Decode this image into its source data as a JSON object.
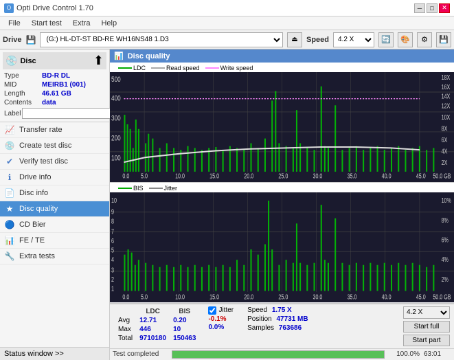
{
  "titlebar": {
    "icon": "O",
    "title": "Opti Drive Control 1.70",
    "min_btn": "─",
    "max_btn": "□",
    "close_btn": "✕"
  },
  "menubar": {
    "items": [
      "File",
      "Start test",
      "Extra",
      "Help"
    ]
  },
  "drivebar": {
    "label": "Drive",
    "drive_value": "(G:)  HL-DT-ST BD-RE  WH16NS48 1.D3",
    "speed_label": "Speed",
    "speed_value": "4.2 X"
  },
  "disc_panel": {
    "title": "Disc",
    "rows": [
      {
        "key": "Type",
        "value": "BD-R DL",
        "color": "blue"
      },
      {
        "key": "MID",
        "value": "MEIRB1 (001)",
        "color": "blue"
      },
      {
        "key": "Length",
        "value": "46.61 GB",
        "color": "blue"
      },
      {
        "key": "Contents",
        "value": "data",
        "color": "blue"
      }
    ],
    "label_key": "Label"
  },
  "sidebar": {
    "items": [
      {
        "id": "transfer-rate",
        "label": "Transfer rate",
        "icon": "📈"
      },
      {
        "id": "create-test-disc",
        "label": "Create test disc",
        "icon": "💿"
      },
      {
        "id": "verify-test-disc",
        "label": "Verify test disc",
        "icon": "✔"
      },
      {
        "id": "drive-info",
        "label": "Drive info",
        "icon": "ℹ"
      },
      {
        "id": "disc-info",
        "label": "Disc info",
        "icon": "📄"
      },
      {
        "id": "disc-quality",
        "label": "Disc quality",
        "icon": "★",
        "active": true
      },
      {
        "id": "cd-bier",
        "label": "CD Bier",
        "icon": "🔵"
      },
      {
        "id": "fe-te",
        "label": "FE / TE",
        "icon": "📊"
      },
      {
        "id": "extra-tests",
        "label": "Extra tests",
        "icon": "🔧"
      }
    ]
  },
  "status_window": {
    "label": "Status window >>",
    "arrow": ">>"
  },
  "chart": {
    "title": "Disc quality",
    "legend_top": [
      {
        "label": "LDC",
        "color": "#00aa00"
      },
      {
        "label": "Read speed",
        "color": "#aaaaaa"
      },
      {
        "label": "Write speed",
        "color": "#ff88ff"
      }
    ],
    "legend_bottom": [
      {
        "label": "BIS",
        "color": "#00aa00"
      },
      {
        "label": "Jitter",
        "color": "#888888"
      }
    ],
    "top_y_max": 500,
    "top_y_right_max": 18,
    "bottom_y_max": 10,
    "bottom_y_right_max": 10,
    "x_max": 50,
    "x_label": "GB"
  },
  "stats": {
    "columns": [
      "",
      "LDC",
      "BIS",
      "",
      "Jitter"
    ],
    "rows": [
      {
        "label": "Avg",
        "ldc": "12.71",
        "bis": "0.20",
        "jitter": "-0.1%"
      },
      {
        "label": "Max",
        "ldc": "446",
        "bis": "10",
        "jitter": "0.0%"
      },
      {
        "label": "Total",
        "ldc": "9710180",
        "bis": "150463",
        "jitter": ""
      }
    ],
    "jitter_checked": true,
    "speed_label": "Speed",
    "speed_value": "1.75 X",
    "position_label": "Position",
    "position_value": "47731 MB",
    "samples_label": "Samples",
    "samples_value": "763686",
    "speed_select": "4.2 X",
    "btn_start_full": "Start full",
    "btn_start_part": "Start part"
  },
  "progress": {
    "percent": 100,
    "percent_label": "100.0%",
    "time": "63:01",
    "status": "Test completed"
  }
}
